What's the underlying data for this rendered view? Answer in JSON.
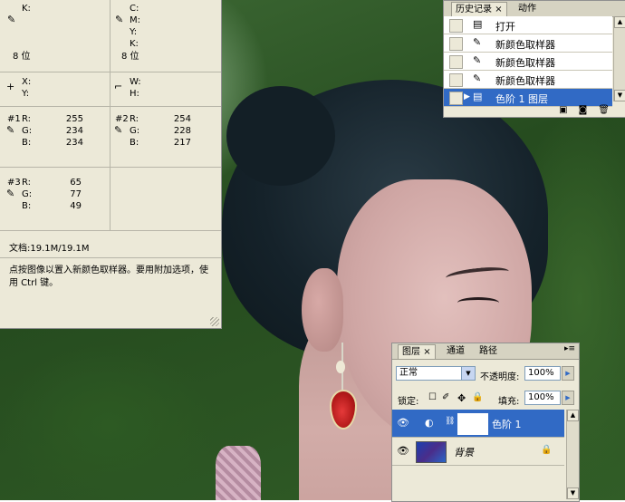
{
  "info": {
    "cmyk": {
      "c": "C:",
      "m": "M:",
      "y": "Y:",
      "k": "K:"
    },
    "bits_left": "8 位",
    "bits_right": "8 位",
    "xy": {
      "x": "X:",
      "y": "Y:"
    },
    "wh": {
      "w": "W:",
      "h": "H:"
    },
    "sampler1": {
      "label": "#1",
      "r": "255",
      "g": "234",
      "b": "234"
    },
    "sampler2": {
      "label": "#2",
      "r": "254",
      "g": "228",
      "b": "217"
    },
    "sampler3": {
      "label": "#3",
      "r": "65",
      "g": "77",
      "b": "49"
    },
    "rgb": {
      "r": "R:",
      "g": "G:",
      "b": "B:"
    },
    "k_label": "K:",
    "doc": "文档:19.1M/19.1M",
    "hint": "点按图像以置入新颜色取样器。要用附加选项，使用 Ctrl 键。"
  },
  "history": {
    "tabs": [
      {
        "label": "历史记录",
        "close": "×"
      },
      {
        "label": "动作"
      }
    ],
    "items": [
      {
        "label": "打开",
        "icon": "document-icon"
      },
      {
        "label": "新颜色取样器",
        "icon": "eyedropper-icon"
      },
      {
        "label": "新颜色取样器",
        "icon": "eyedropper-icon"
      },
      {
        "label": "新颜色取样器",
        "icon": "eyedropper-icon"
      },
      {
        "label": "色阶 1 图层",
        "icon": "document-icon",
        "selected": true
      }
    ]
  },
  "layers": {
    "tabs": [
      {
        "label": "图层",
        "close": "×"
      },
      {
        "label": "通道"
      },
      {
        "label": "路径"
      }
    ],
    "blend_mode": "正常",
    "opacity_label": "不透明度:",
    "opacity": "100%",
    "lock_label": "锁定:",
    "fill_label": "填充:",
    "fill": "100%",
    "rows": [
      {
        "name": "色阶 1",
        "selected": true
      },
      {
        "name": "背景"
      }
    ]
  },
  "colors": {
    "selection": "#316ac5",
    "panel": "#ece9d8"
  }
}
